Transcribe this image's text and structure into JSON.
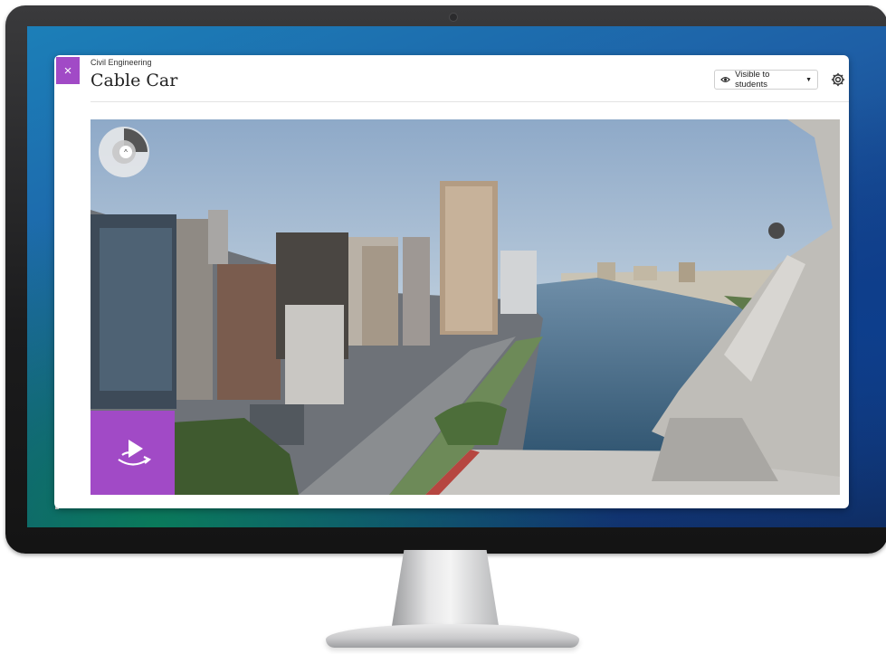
{
  "app": {
    "breadcrumb": "Civil Engineering",
    "title": "Cable Car"
  },
  "header": {
    "visibility_label": "Visible to students",
    "visibility_icon": "eye-icon",
    "settings_icon": "gear-icon",
    "close_icon": "close-icon",
    "close_glyph": "×"
  },
  "viewer": {
    "compass_icon": "compass-icon",
    "compass_glyph": "^",
    "play_icon": "play-360-icon"
  },
  "colors": {
    "accent": "#a14ac6",
    "monitor_bezel": "#1b1b1c"
  }
}
